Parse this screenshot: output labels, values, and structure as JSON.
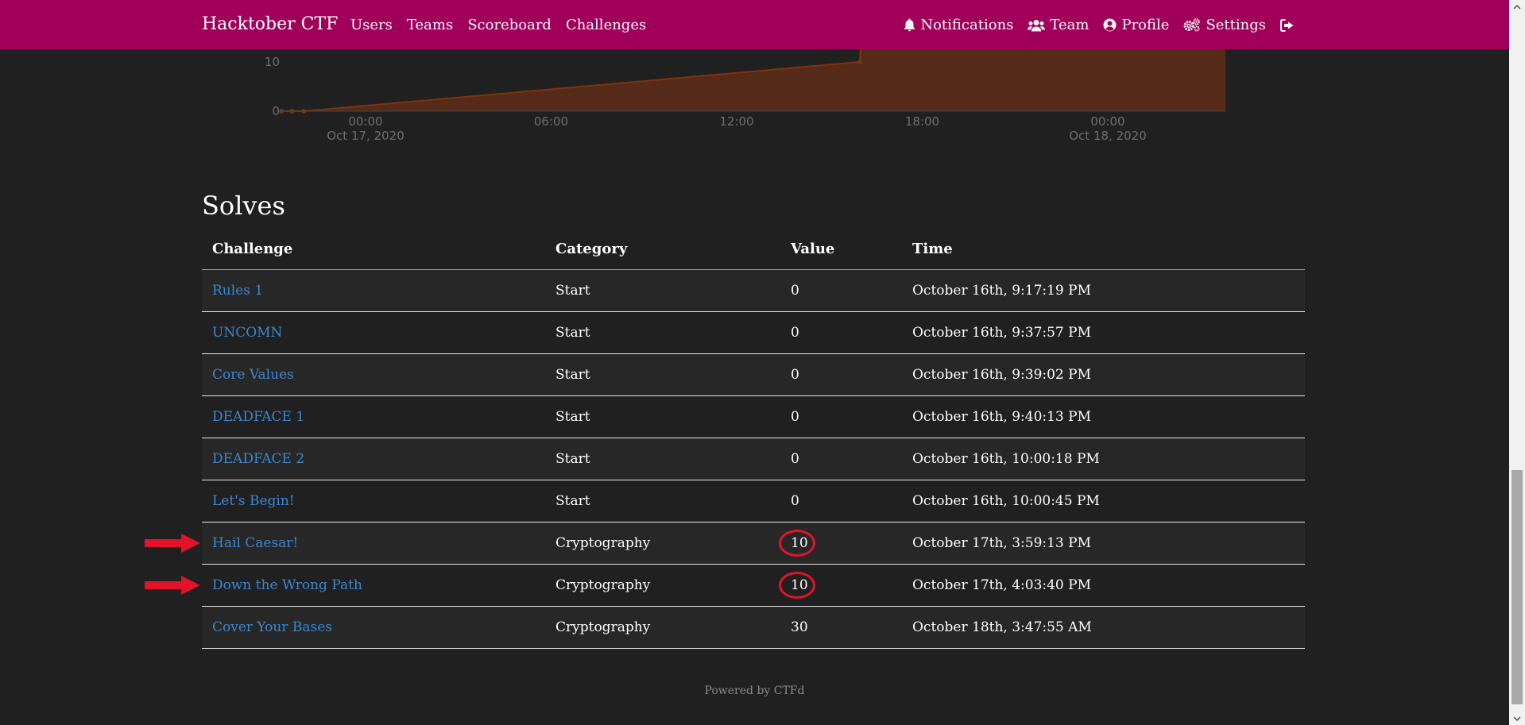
{
  "navbar": {
    "brand": "Hacktober CTF",
    "left_links": [
      "Users",
      "Teams",
      "Scoreboard",
      "Challenges"
    ],
    "right_links": [
      {
        "label": "Notifications",
        "icon": "bell-icon"
      },
      {
        "label": "Team",
        "icon": "users-icon"
      },
      {
        "label": "Profile",
        "icon": "user-circle-icon"
      },
      {
        "label": "Settings",
        "icon": "cogs-icon"
      }
    ],
    "logout_icon": "sign-out-icon",
    "color": "#a0005a"
  },
  "chart_data": {
    "type": "area",
    "ylabel": "",
    "xlabel": "",
    "y_ticks": [
      "0",
      "10"
    ],
    "x_ticks": [
      {
        "time": "00:00",
        "date": "Oct 17, 2020"
      },
      {
        "time": "06:00",
        "date": ""
      },
      {
        "time": "12:00",
        "date": ""
      },
      {
        "time": "18:00",
        "date": ""
      },
      {
        "time": "00:00",
        "date": "Oct 18, 2020"
      }
    ],
    "series": [
      {
        "color": "#5a2a18",
        "points": [
          {
            "x": "2020-10-16 21:17",
            "y": 0
          },
          {
            "x": "2020-10-16 21:37",
            "y": 0
          },
          {
            "x": "2020-10-16 22:00",
            "y": 0
          },
          {
            "x": "2020-10-17 15:59",
            "y": 10
          },
          {
            "x": "2020-10-17 16:03",
            "y": 20
          },
          {
            "x": "2020-10-18 03:47",
            "y": 50
          }
        ]
      }
    ]
  },
  "solves": {
    "title": "Solves",
    "headers": [
      "Challenge",
      "Category",
      "Value",
      "Time"
    ],
    "rows": [
      {
        "challenge": "Rules 1",
        "category": "Start",
        "value": "0",
        "time": "October 16th, 9:17:19 PM"
      },
      {
        "challenge": "UNCOMN",
        "category": "Start",
        "value": "0",
        "time": "October 16th, 9:37:57 PM"
      },
      {
        "challenge": "Core Values",
        "category": "Start",
        "value": "0",
        "time": "October 16th, 9:39:02 PM"
      },
      {
        "challenge": "DEADFACE 1",
        "category": "Start",
        "value": "0",
        "time": "October 16th, 9:40:13 PM"
      },
      {
        "challenge": "DEADFACE 2",
        "category": "Start",
        "value": "0",
        "time": "October 16th, 10:00:18 PM"
      },
      {
        "challenge": "Let's Begin!",
        "category": "Start",
        "value": "0",
        "time": "October 16th, 10:00:45 PM"
      },
      {
        "challenge": "Hail Caesar!",
        "category": "Cryptography",
        "value": "10",
        "time": "October 17th, 3:59:13 PM"
      },
      {
        "challenge": "Down the Wrong Path",
        "category": "Cryptography",
        "value": "10",
        "time": "October 17th, 4:03:40 PM"
      },
      {
        "challenge": "Cover Your Bases",
        "category": "Cryptography",
        "value": "30",
        "time": "October 18th, 3:47:55 AM"
      }
    ]
  },
  "annotations": {
    "arrow_color": "#e3122b",
    "arrow_rows": [
      6,
      7
    ],
    "circled_value_rows": [
      6,
      7
    ]
  },
  "footer": {
    "text": "Powered by CTFd"
  }
}
